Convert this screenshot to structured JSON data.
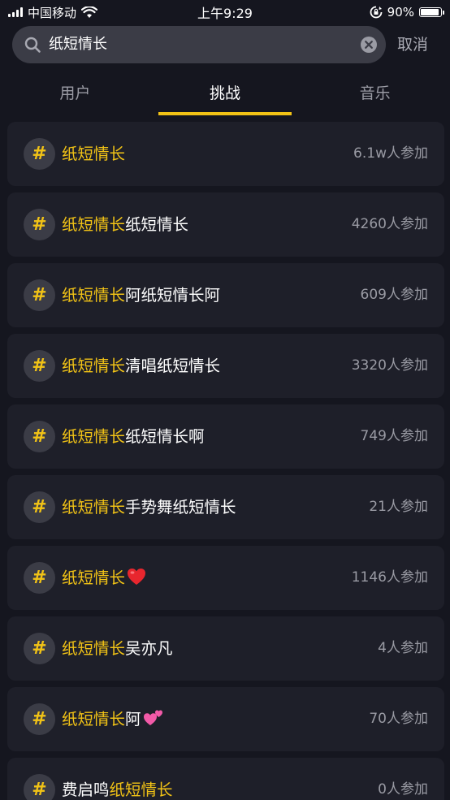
{
  "status_bar": {
    "carrier": "中国移动",
    "time": "上午9:29",
    "battery": "90%",
    "battery_level": 0.9
  },
  "search": {
    "value": "纸短情长",
    "cancel_label": "取消"
  },
  "tabs": [
    {
      "label": "用户",
      "active": false
    },
    {
      "label": "挑战",
      "active": true
    },
    {
      "label": "音乐",
      "active": false
    }
  ],
  "colors": {
    "accent": "#f2c316",
    "background": "#15161f",
    "card": "#1e1f29"
  },
  "results": [
    {
      "prefix": "",
      "highlight": "纸短情长",
      "suffix": "",
      "emoji": "",
      "count": "6.1w人参加"
    },
    {
      "prefix": "",
      "highlight": "纸短情长",
      "suffix": "纸短情长",
      "emoji": "",
      "count": "4260人参加"
    },
    {
      "prefix": "",
      "highlight": "纸短情长",
      "suffix": "阿纸短情长阿",
      "emoji": "",
      "count": "609人参加"
    },
    {
      "prefix": "",
      "highlight": "纸短情长",
      "suffix": "清唱纸短情长",
      "emoji": "",
      "count": "3320人参加"
    },
    {
      "prefix": "",
      "highlight": "纸短情长",
      "suffix": "纸短情长啊",
      "emoji": "",
      "count": "749人参加"
    },
    {
      "prefix": "",
      "highlight": "纸短情长",
      "suffix": "手势舞纸短情长",
      "emoji": "",
      "count": "21人参加"
    },
    {
      "prefix": "",
      "highlight": "纸短情长",
      "suffix": "",
      "emoji": "red-heart-emoji",
      "count": "1146人参加"
    },
    {
      "prefix": "",
      "highlight": "纸短情长",
      "suffix": "吴亦凡",
      "emoji": "",
      "count": "4人参加"
    },
    {
      "prefix": "",
      "highlight": "纸短情长",
      "suffix": "阿",
      "emoji": "two-hearts-emoji",
      "count": "70人参加"
    },
    {
      "prefix": "费启鸣",
      "highlight": "纸短情长",
      "suffix": "",
      "emoji": "",
      "count": "0人参加"
    }
  ]
}
